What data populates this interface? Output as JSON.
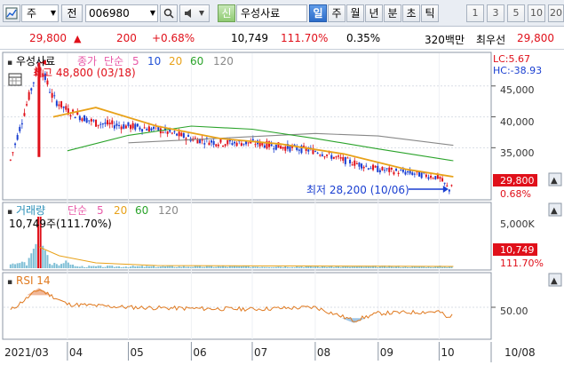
{
  "toolbar": {
    "type_select": "주",
    "prev_label": "전",
    "stock_code": "006980",
    "credit_badge": "신",
    "stock_name": "우성사료",
    "period_tabs": [
      "일",
      "주",
      "월",
      "년",
      "분",
      "초",
      "틱"
    ],
    "active_tab": "일",
    "minute_buttons": [
      "1",
      "3",
      "5",
      "10",
      "20"
    ]
  },
  "quote": {
    "price": "29,800",
    "change_arrow": "▲",
    "change": "200",
    "change_pct": "+0.68%",
    "volume": "10,749",
    "volume_ratio": "111.70%",
    "turnover": "0.35%",
    "trade_value": "320백만",
    "pref_label": "최우선",
    "pref_price": "29,800"
  },
  "price_panel": {
    "stock_name": "우성사료",
    "indicator_label": "종가",
    "ma_label": "단순",
    "ma_periods": [
      "5",
      "10",
      "20",
      "60",
      "120"
    ],
    "ma_colors": [
      "#e85aa8",
      "#1e4fd6",
      "#e8a21a",
      "#2aa32a",
      "#888888"
    ],
    "high_annotation": "최고 48,800 (03/18)",
    "low_annotation": "최저 28,200 (10/06)",
    "lc_label": "LC:5.67",
    "hc_label": "HC:-38.93",
    "y_ticks": [
      "45,000",
      "40,000",
      "35,000"
    ],
    "last_price_tag": "29,800",
    "last_pct_tag": "0.68%"
  },
  "volume_panel": {
    "title": "거래량",
    "ma_label": "단순",
    "ma_periods": [
      "5",
      "20",
      "60",
      "120"
    ],
    "value_label": "10,749주(111.70%)",
    "y_tick": "5,000K",
    "last_tag": "10,749",
    "last_pct": "111.70%"
  },
  "rsi_panel": {
    "title": "RSI 14",
    "y_tick": "50.00"
  },
  "x_axis": {
    "labels": [
      "2021/03",
      "04",
      "05",
      "06",
      "07",
      "08",
      "09",
      "10",
      "10/08"
    ]
  },
  "chart_data": {
    "type": "line",
    "title": "우성사료",
    "series": [
      {
        "name": "종가",
        "x": [
          "03/04",
          "03/18",
          "03/25",
          "04/01",
          "04/15",
          "05/01",
          "05/15",
          "06/01",
          "06/15",
          "07/01",
          "07/15",
          "08/01",
          "08/15",
          "09/01",
          "09/15",
          "10/01",
          "10/06",
          "10/08"
        ],
        "values": [
          33000,
          48800,
          43000,
          41000,
          39000,
          38500,
          38000,
          36500,
          35800,
          35800,
          35200,
          34500,
          33000,
          31500,
          31000,
          30200,
          28200,
          29800
        ]
      },
      {
        "name": "120",
        "x": [
          "05/01",
          "06/01",
          "07/01",
          "08/01",
          "09/01",
          "10/08"
        ],
        "values": [
          35800,
          36300,
          36800,
          37300,
          36900,
          35400
        ]
      },
      {
        "name": "60",
        "x": [
          "04/01",
          "05/01",
          "06/01",
          "07/01",
          "08/01",
          "09/01",
          "10/08"
        ],
        "values": [
          34500,
          37000,
          38500,
          38000,
          36500,
          34800,
          32900
        ]
      },
      {
        "name": "20",
        "x": [
          "03/25",
          "04/15",
          "05/15",
          "06/15",
          "07/15",
          "08/15",
          "09/15",
          "10/08"
        ],
        "values": [
          40000,
          41500,
          38500,
          36500,
          35600,
          34000,
          31500,
          30300
        ]
      }
    ],
    "ylim": [
      27000,
      50000
    ],
    "rsi": {
      "x": [
        "03/04",
        "03/18",
        "04/01",
        "05/01",
        "06/01",
        "07/01",
        "08/01",
        "08/20",
        "09/01",
        "10/01",
        "10/06",
        "10/08"
      ],
      "values": [
        45,
        80,
        55,
        50,
        48,
        47,
        50,
        28,
        40,
        43,
        30,
        42
      ],
      "ylim": [
        0,
        100
      ]
    }
  }
}
